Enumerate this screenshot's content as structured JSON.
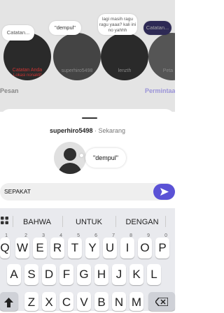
{
  "background": {
    "notes": [
      {
        "text": "Catatan..."
      },
      {
        "text": "\"dempul\""
      },
      {
        "text": "lagi masih ragu ragu yaaa? kali ini no yahhh"
      },
      {
        "text": "Catatan..."
      }
    ],
    "names": [
      {
        "name": "Catatan Anda",
        "sub": "Lokasi nonaktif"
      },
      {
        "name": "superhiro5498"
      },
      {
        "name": "lenzth"
      },
      {
        "name": "Peta"
      }
    ],
    "tab_left": "Pesan",
    "tab_right": "Permintaan"
  },
  "sheet": {
    "username": "superhiro5498",
    "time": "· Sekarang",
    "note": "\"dempul\"",
    "reply_text": "SEPAKAT"
  },
  "keyboard": {
    "suggestions": [
      "BAHWA",
      "UNTUK",
      "DENGAN"
    ],
    "row1": [
      {
        "k": "Q",
        "n": "1"
      },
      {
        "k": "W",
        "n": "2"
      },
      {
        "k": "E",
        "n": "3"
      },
      {
        "k": "R",
        "n": "4"
      },
      {
        "k": "T",
        "n": "5"
      },
      {
        "k": "Y",
        "n": "6"
      },
      {
        "k": "U",
        "n": "7"
      },
      {
        "k": "I",
        "n": "8"
      },
      {
        "k": "O",
        "n": "9"
      },
      {
        "k": "P",
        "n": "0"
      }
    ],
    "row2": [
      "A",
      "S",
      "D",
      "F",
      "G",
      "H",
      "J",
      "K",
      "L"
    ],
    "row3": [
      "Z",
      "X",
      "C",
      "V",
      "B",
      "N",
      "M"
    ]
  },
  "colors": {
    "accent": "#5b52d6",
    "note_blue": "#3c2fd0"
  }
}
